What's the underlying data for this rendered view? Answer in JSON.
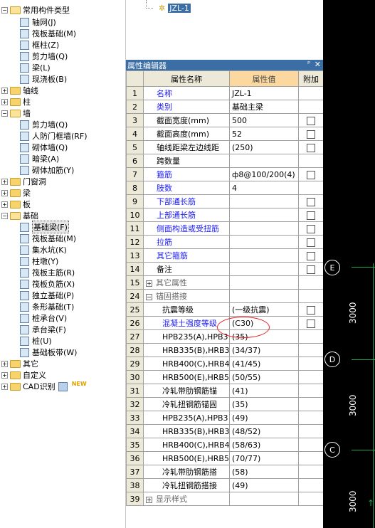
{
  "tree": {
    "common": "常用构件类型",
    "common_items": [
      "轴网(J)",
      "筏板基础(M)",
      "框柱(Z)",
      "剪力墙(Q)",
      "梁(L)",
      "现浇板(B)"
    ],
    "axis": "轴线",
    "column": "柱",
    "wall": "墙",
    "wall_items": [
      "剪力墙(Q)",
      "人防门框墙(RF)",
      "砌体墙(Q)",
      "暗梁(A)",
      "砌体加筋(Y)"
    ],
    "door": "门窗洞",
    "beam": "梁",
    "slab": "板",
    "foundation": "基础",
    "foundation_items": [
      "基础梁(F)",
      "筏板基础(M)",
      "集水坑(K)",
      "柱墩(Y)",
      "筏板主筋(R)",
      "筏板负筋(X)",
      "独立基础(P)",
      "条形基础(T)",
      "桩承台(V)",
      "承台梁(F)",
      "桩(U)",
      "基础板带(W)"
    ],
    "other": "其它",
    "custom": "自定义",
    "cad": "CAD识别",
    "new_badge": "NEW"
  },
  "top": {
    "node": "JZL-1"
  },
  "editor": {
    "title": "属性编辑器",
    "pin": "ᵖ",
    "close": "✕",
    "col_name": "属性名称",
    "col_value": "属性值",
    "col_extra": "附加",
    "rows": [
      {
        "n": "1",
        "name": "名称",
        "val": "JZL-1"
      },
      {
        "n": "2",
        "name": "类别",
        "val": "基础主梁"
      },
      {
        "n": "3",
        "name": "截面宽度(mm)",
        "val": "500"
      },
      {
        "n": "4",
        "name": "截面高度(mm)",
        "val": "52"
      },
      {
        "n": "5",
        "name": "轴线距梁左边线距",
        "val": "(250)"
      },
      {
        "n": "6",
        "name": "跨数量",
        "val": ""
      },
      {
        "n": "7",
        "name": "箍筋",
        "val": "ф8@100/200(4)"
      },
      {
        "n": "8",
        "name": "肢数",
        "val": "4"
      },
      {
        "n": "9",
        "name": "下部通长筋",
        "val": ""
      },
      {
        "n": "10",
        "name": "上部通长筋",
        "val": ""
      },
      {
        "n": "11",
        "name": "侧面构造或受扭筋",
        "val": ""
      },
      {
        "n": "12",
        "name": "拉筋",
        "val": ""
      },
      {
        "n": "13",
        "name": "其它箍筋",
        "val": ""
      },
      {
        "n": "14",
        "name": "备注",
        "val": ""
      },
      {
        "n": "15",
        "name": "其它属性",
        "val": ""
      },
      {
        "n": "24",
        "name": "锚固搭接",
        "val": ""
      },
      {
        "n": "25",
        "name": "抗震等级",
        "val": "(一级抗震)"
      },
      {
        "n": "26",
        "name": "混凝土强度等级",
        "val": "(C30)"
      },
      {
        "n": "27",
        "name": "HPB235(A),HPB3",
        "val": "(35)"
      },
      {
        "n": "28",
        "name": "HRB335(B),HRB3",
        "val": "(34/37)"
      },
      {
        "n": "29",
        "name": "HRB400(C),HRB4",
        "val": "(41/45)"
      },
      {
        "n": "30",
        "name": "HRB500(E),HRB5",
        "val": "(50/55)"
      },
      {
        "n": "31",
        "name": "冷轧带肋钢筋锚",
        "val": "(41)"
      },
      {
        "n": "32",
        "name": "冷轧扭钢筋锚固",
        "val": "(35)"
      },
      {
        "n": "33",
        "name": "HPB235(A),HPB3",
        "val": "(49)"
      },
      {
        "n": "34",
        "name": "HRB335(B),HRB3",
        "val": "(48/52)"
      },
      {
        "n": "35",
        "name": "HRB400(C),HRB4",
        "val": "(58/63)"
      },
      {
        "n": "36",
        "name": "HRB500(E),HRB5",
        "val": "(70/77)"
      },
      {
        "n": "37",
        "name": "冷轧带肋钢筋搭",
        "val": "(58)"
      },
      {
        "n": "38",
        "name": "冷轧扭钢筋搭接",
        "val": "(49)"
      },
      {
        "n": "39",
        "name": "显示样式",
        "val": ""
      }
    ]
  },
  "canvas": {
    "axes": [
      "E",
      "D",
      "C"
    ],
    "dims": [
      "3000",
      "3000",
      "3000"
    ]
  }
}
